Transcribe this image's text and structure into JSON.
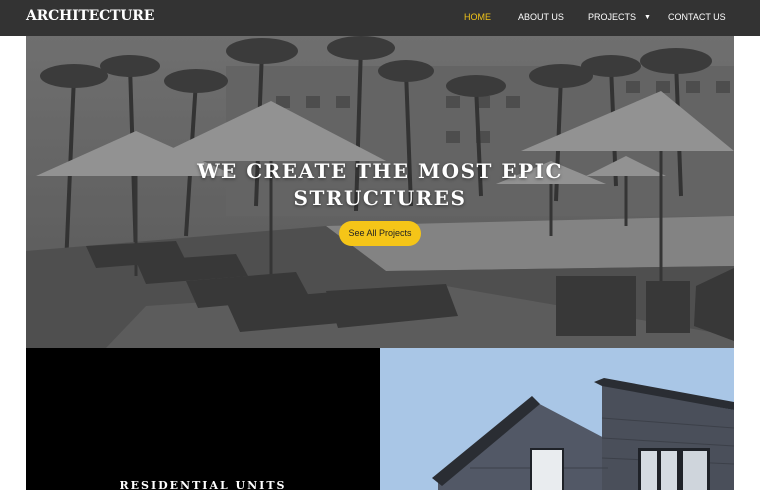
{
  "brand": {
    "name": "ARCHITECTURE"
  },
  "nav": {
    "items": [
      {
        "label": "HOME",
        "active": true
      },
      {
        "label": "ABOUT US",
        "active": false
      },
      {
        "label": "PROJECTS",
        "active": false,
        "has_dropdown": true
      },
      {
        "label": "CONTACT US",
        "active": false
      }
    ],
    "dropdown_icon": "caret-down-icon"
  },
  "hero": {
    "title_line1": "WE CREATE THE MOST EPIC",
    "title_line2": "STRUCTURES",
    "cta_label": "See All Projects"
  },
  "sections": {
    "residential_label": "RESIDENTIAL UNITS"
  },
  "colors": {
    "navbar_bg": "#333333",
    "accent": "#f5c518",
    "active_nav": "#f0c419",
    "panel_dark": "#000000"
  }
}
